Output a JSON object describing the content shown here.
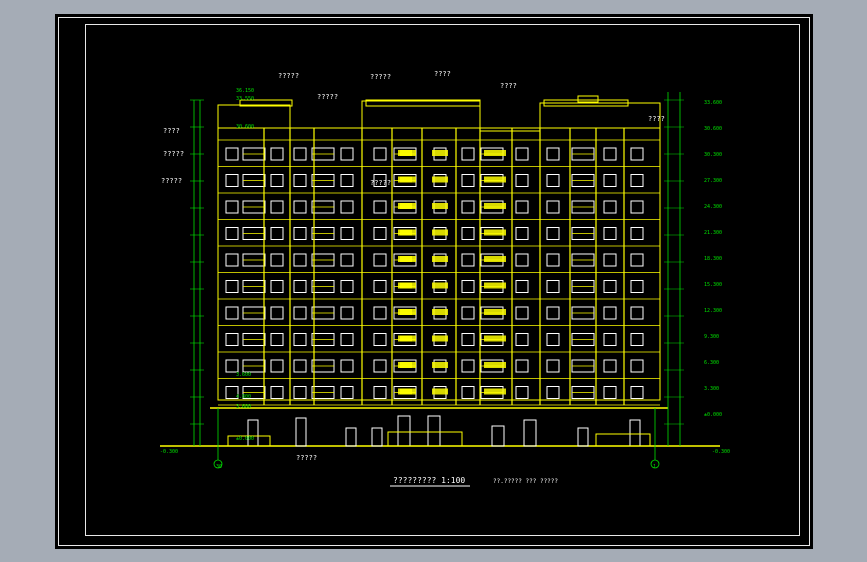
{
  "drawing": {
    "title": "????????? 1:100",
    "subtitle": "??.????? ??? ?????",
    "axis_left": "30",
    "axis_right": "1",
    "level_bottom_left": "-0.300",
    "level_bottom_right": "-0.300"
  },
  "notes": {
    "top1": "?????",
    "top2": "?????",
    "top3": "?????",
    "top4": "????",
    "top5": "????",
    "left1": "????",
    "left2": "?????",
    "left3": "?????",
    "mid1": "?????",
    "right1": "????",
    "bottom1": "?????"
  },
  "levels_left": [
    "36.150",
    "33.550",
    "30.600",
    "3.600",
    "4.800",
    "3.600",
    "±0.000"
  ],
  "levels_right": [
    "33.600",
    "30.600",
    "30.300",
    "27.300",
    "24.300",
    "21.300",
    "18.300",
    "15.300",
    "12.300",
    "9.300",
    "6.300",
    "3.300",
    "±0.000"
  ],
  "colors": {
    "building": "#ffff00",
    "dim": "#00e000",
    "frame": "#e8e8e8",
    "bg": "#000000"
  }
}
